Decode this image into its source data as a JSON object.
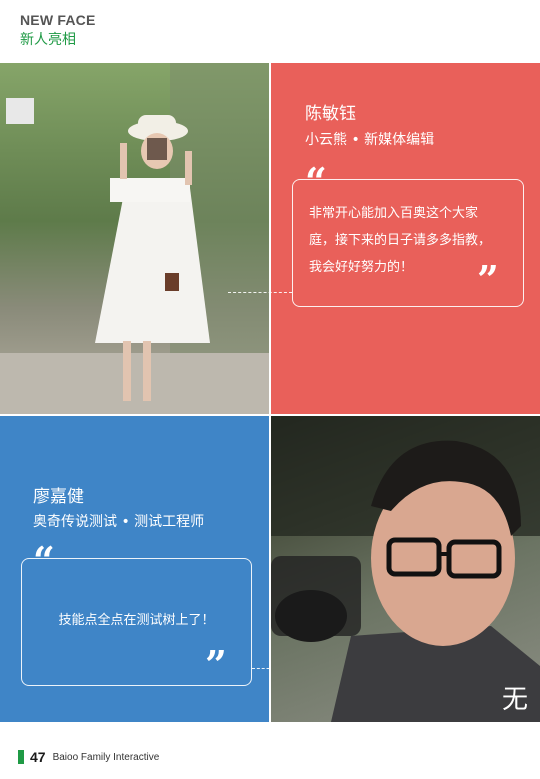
{
  "header": {
    "title_en": "NEW FACE",
    "title_cn": "新人亮相"
  },
  "person1": {
    "name": "陈敏钰",
    "role": "小云熊 • 新媒体编辑",
    "quote_lines": [
      "非常开心能加入百奥这个大家",
      "庭，接下来的日子请多多指教，",
      "我会好好努力的！"
    ]
  },
  "person2": {
    "name": "廖嘉健",
    "role": "奥奇传说测试 • 测试工程师",
    "quote_lines": [
      "技能点全点在测试树上了！"
    ],
    "photo_caption": "无"
  },
  "footer": {
    "page_number": "47",
    "brand": "Baioo Family Interactive"
  },
  "colors": {
    "red_panel": "#e9605a",
    "blue_panel": "#3f85c7",
    "accent_green": "#1f9a45"
  }
}
